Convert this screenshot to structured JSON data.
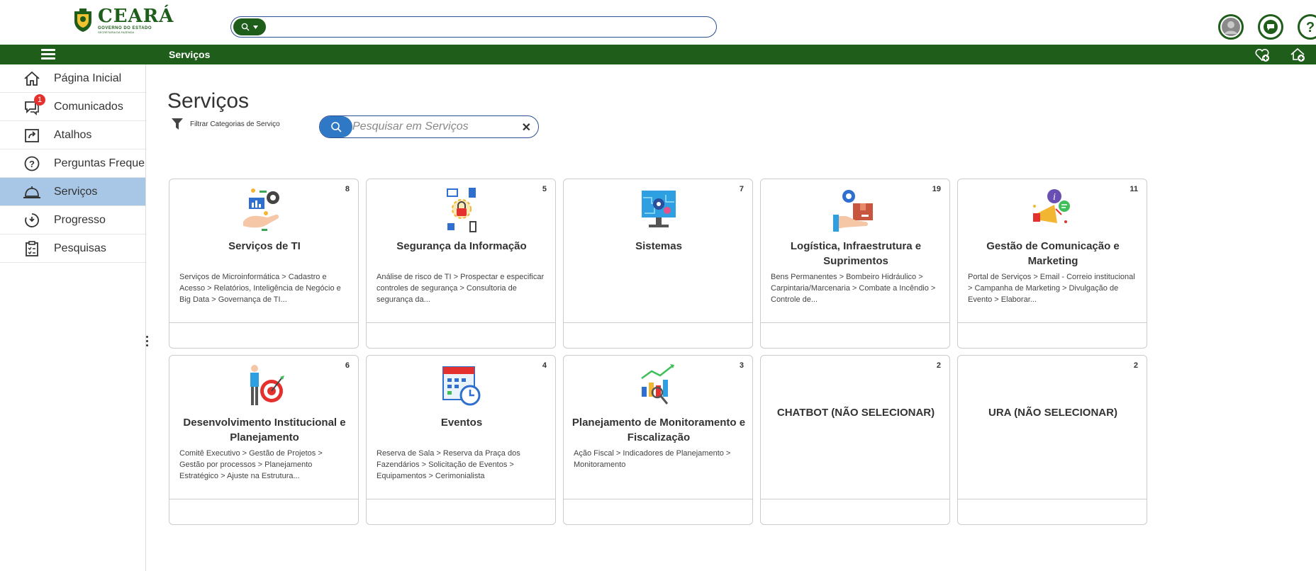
{
  "header": {
    "logo_brand": "CEARÁ",
    "logo_subtitle": "GOVERNO DO ESTADO",
    "logo_subtitle2": "SECRETARIA DA FAZENDA",
    "search_value": "",
    "search_pill_icon": "search-icon"
  },
  "greenbar": {
    "title": "Serviços"
  },
  "sidebar": {
    "items": [
      {
        "label": "Página Inicial",
        "icon": "home-icon"
      },
      {
        "label": "Comunicados",
        "icon": "chat-icon",
        "badge": "1"
      },
      {
        "label": "Atalhos",
        "icon": "shortcut-icon"
      },
      {
        "label": "Perguntas Frequentes",
        "icon": "question-icon"
      },
      {
        "label": "Serviços",
        "icon": "service-bell-icon"
      },
      {
        "label": "Progresso",
        "icon": "progress-icon"
      },
      {
        "label": "Pesquisas",
        "icon": "clipboard-icon"
      }
    ]
  },
  "main": {
    "title": "Serviços",
    "filter_label": "Filtrar Categorias de Serviço",
    "search_placeholder": "Pesquisar em Serviços",
    "clear_glyph": "✕"
  },
  "cards": [
    {
      "count": "8",
      "title": "Serviços de TI",
      "desc": "Serviços de Microinformática > Cadastro e Acesso > Relatórios, Inteligência de Negócio e Big Data > Governança de TI..."
    },
    {
      "count": "5",
      "title": "Segurança da Informação",
      "desc": "Análise de risco de TI > Prospectar e especificar controles de segurança > Consultoria de segurança da..."
    },
    {
      "count": "7",
      "title": "Sistemas",
      "desc": ""
    },
    {
      "count": "19",
      "title": "Logística, Infraestrutura e Suprimentos",
      "desc": "Bens Permanentes > Bombeiro Hidráulico > Carpintaria/Marcenaria > Combate a Incêndio > Controle de..."
    },
    {
      "count": "11",
      "title": "Gestão de Comunicação e Marketing",
      "desc": "Portal de Serviços > Email - Correio institucional > Campanha de Marketing > Divulgação de Evento > Elaborar..."
    },
    {
      "count": "6",
      "title": "Desenvolvimento Institucional e Planejamento",
      "desc": "Comitê Executivo > Gestão de Projetos > Gestão por processos > Planejamento Estratégico > Ajuste na Estrutura..."
    },
    {
      "count": "4",
      "title": "Eventos",
      "desc": "Reserva de Sala > Reserva da Praça dos Fazendários > Solicitação de Eventos > Equipamentos > Cerimonialista"
    },
    {
      "count": "3",
      "title": "Planejamento de Monitoramento e Fiscalização",
      "desc": "Ação Fiscal > Indicadores de Planejamento > Monitoramento"
    },
    {
      "count": "2",
      "title": "CHATBOT (NÃO SELECIONAR)",
      "desc": ""
    },
    {
      "count": "2",
      "title": "URA (NÃO SELECIONAR)",
      "desc": ""
    }
  ],
  "colors": {
    "brand_green": "#1f5d1b",
    "accent_blue": "#2f78c6",
    "active_bg": "#a8c6e6"
  }
}
